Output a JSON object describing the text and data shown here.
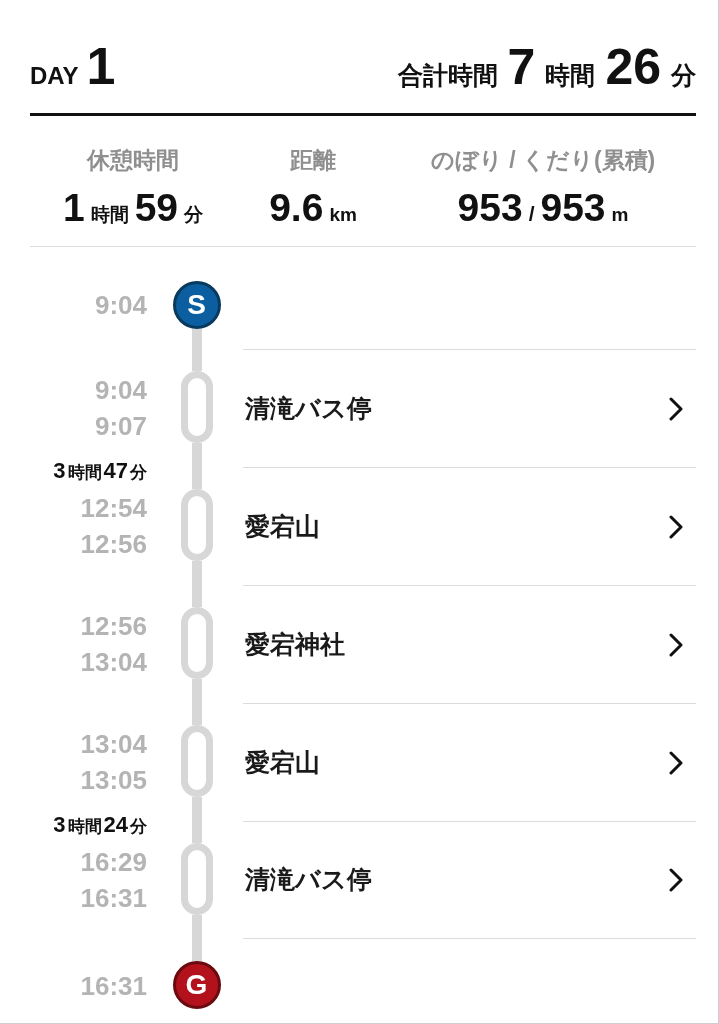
{
  "header": {
    "day_label": "DAY",
    "day_number": "1",
    "total_label": "合計時間",
    "total_value": [
      {
        "kind": "number",
        "text": "7"
      },
      {
        "kind": "unit",
        "text": "時間"
      },
      {
        "kind": "number",
        "text": "26"
      },
      {
        "kind": "unit",
        "text": "分"
      }
    ]
  },
  "stats": [
    {
      "label": "休憩時間",
      "value": [
        {
          "kind": "number",
          "text": "1"
        },
        {
          "kind": "unit",
          "text": "時間"
        },
        {
          "kind": "number",
          "text": "59"
        },
        {
          "kind": "unit",
          "text": "分"
        }
      ]
    },
    {
      "label": "距離",
      "value": [
        {
          "kind": "number",
          "text": "9.6"
        },
        {
          "kind": "unit",
          "text": "km"
        }
      ]
    },
    {
      "label": "のぼり / くだり(累積)",
      "value": [
        {
          "kind": "number",
          "text": "953"
        },
        {
          "kind": "separator",
          "text": "/"
        },
        {
          "kind": "number",
          "text": "953"
        },
        {
          "kind": "unit",
          "text": "m"
        }
      ]
    }
  ],
  "timeline": {
    "start": {
      "kind": "start",
      "marker": "S",
      "time": "9:04"
    },
    "stops": [
      {
        "arrive": "9:04",
        "depart": "9:07",
        "name": "清滝バス停"
      },
      {
        "leg_time": [
          {
            "kind": "number",
            "text": "3"
          },
          {
            "kind": "unit",
            "text": "時間"
          },
          {
            "kind": "number",
            "text": "47"
          },
          {
            "kind": "unit",
            "text": "分"
          }
        ],
        "arrive": "12:54",
        "depart": "12:56",
        "name": "愛宕山"
      },
      {
        "arrive": "12:56",
        "depart": "13:04",
        "name": "愛宕神社"
      },
      {
        "arrive": "13:04",
        "depart": "13:05",
        "name": "愛宕山"
      },
      {
        "leg_time": [
          {
            "kind": "number",
            "text": "3"
          },
          {
            "kind": "unit",
            "text": "時間"
          },
          {
            "kind": "number",
            "text": "24"
          },
          {
            "kind": "unit",
            "text": "分"
          }
        ],
        "arrive": "16:29",
        "depart": "16:31",
        "name": "清滝バス停"
      }
    ],
    "goal": {
      "kind": "goal",
      "marker": "G",
      "time": "16:31"
    }
  }
}
